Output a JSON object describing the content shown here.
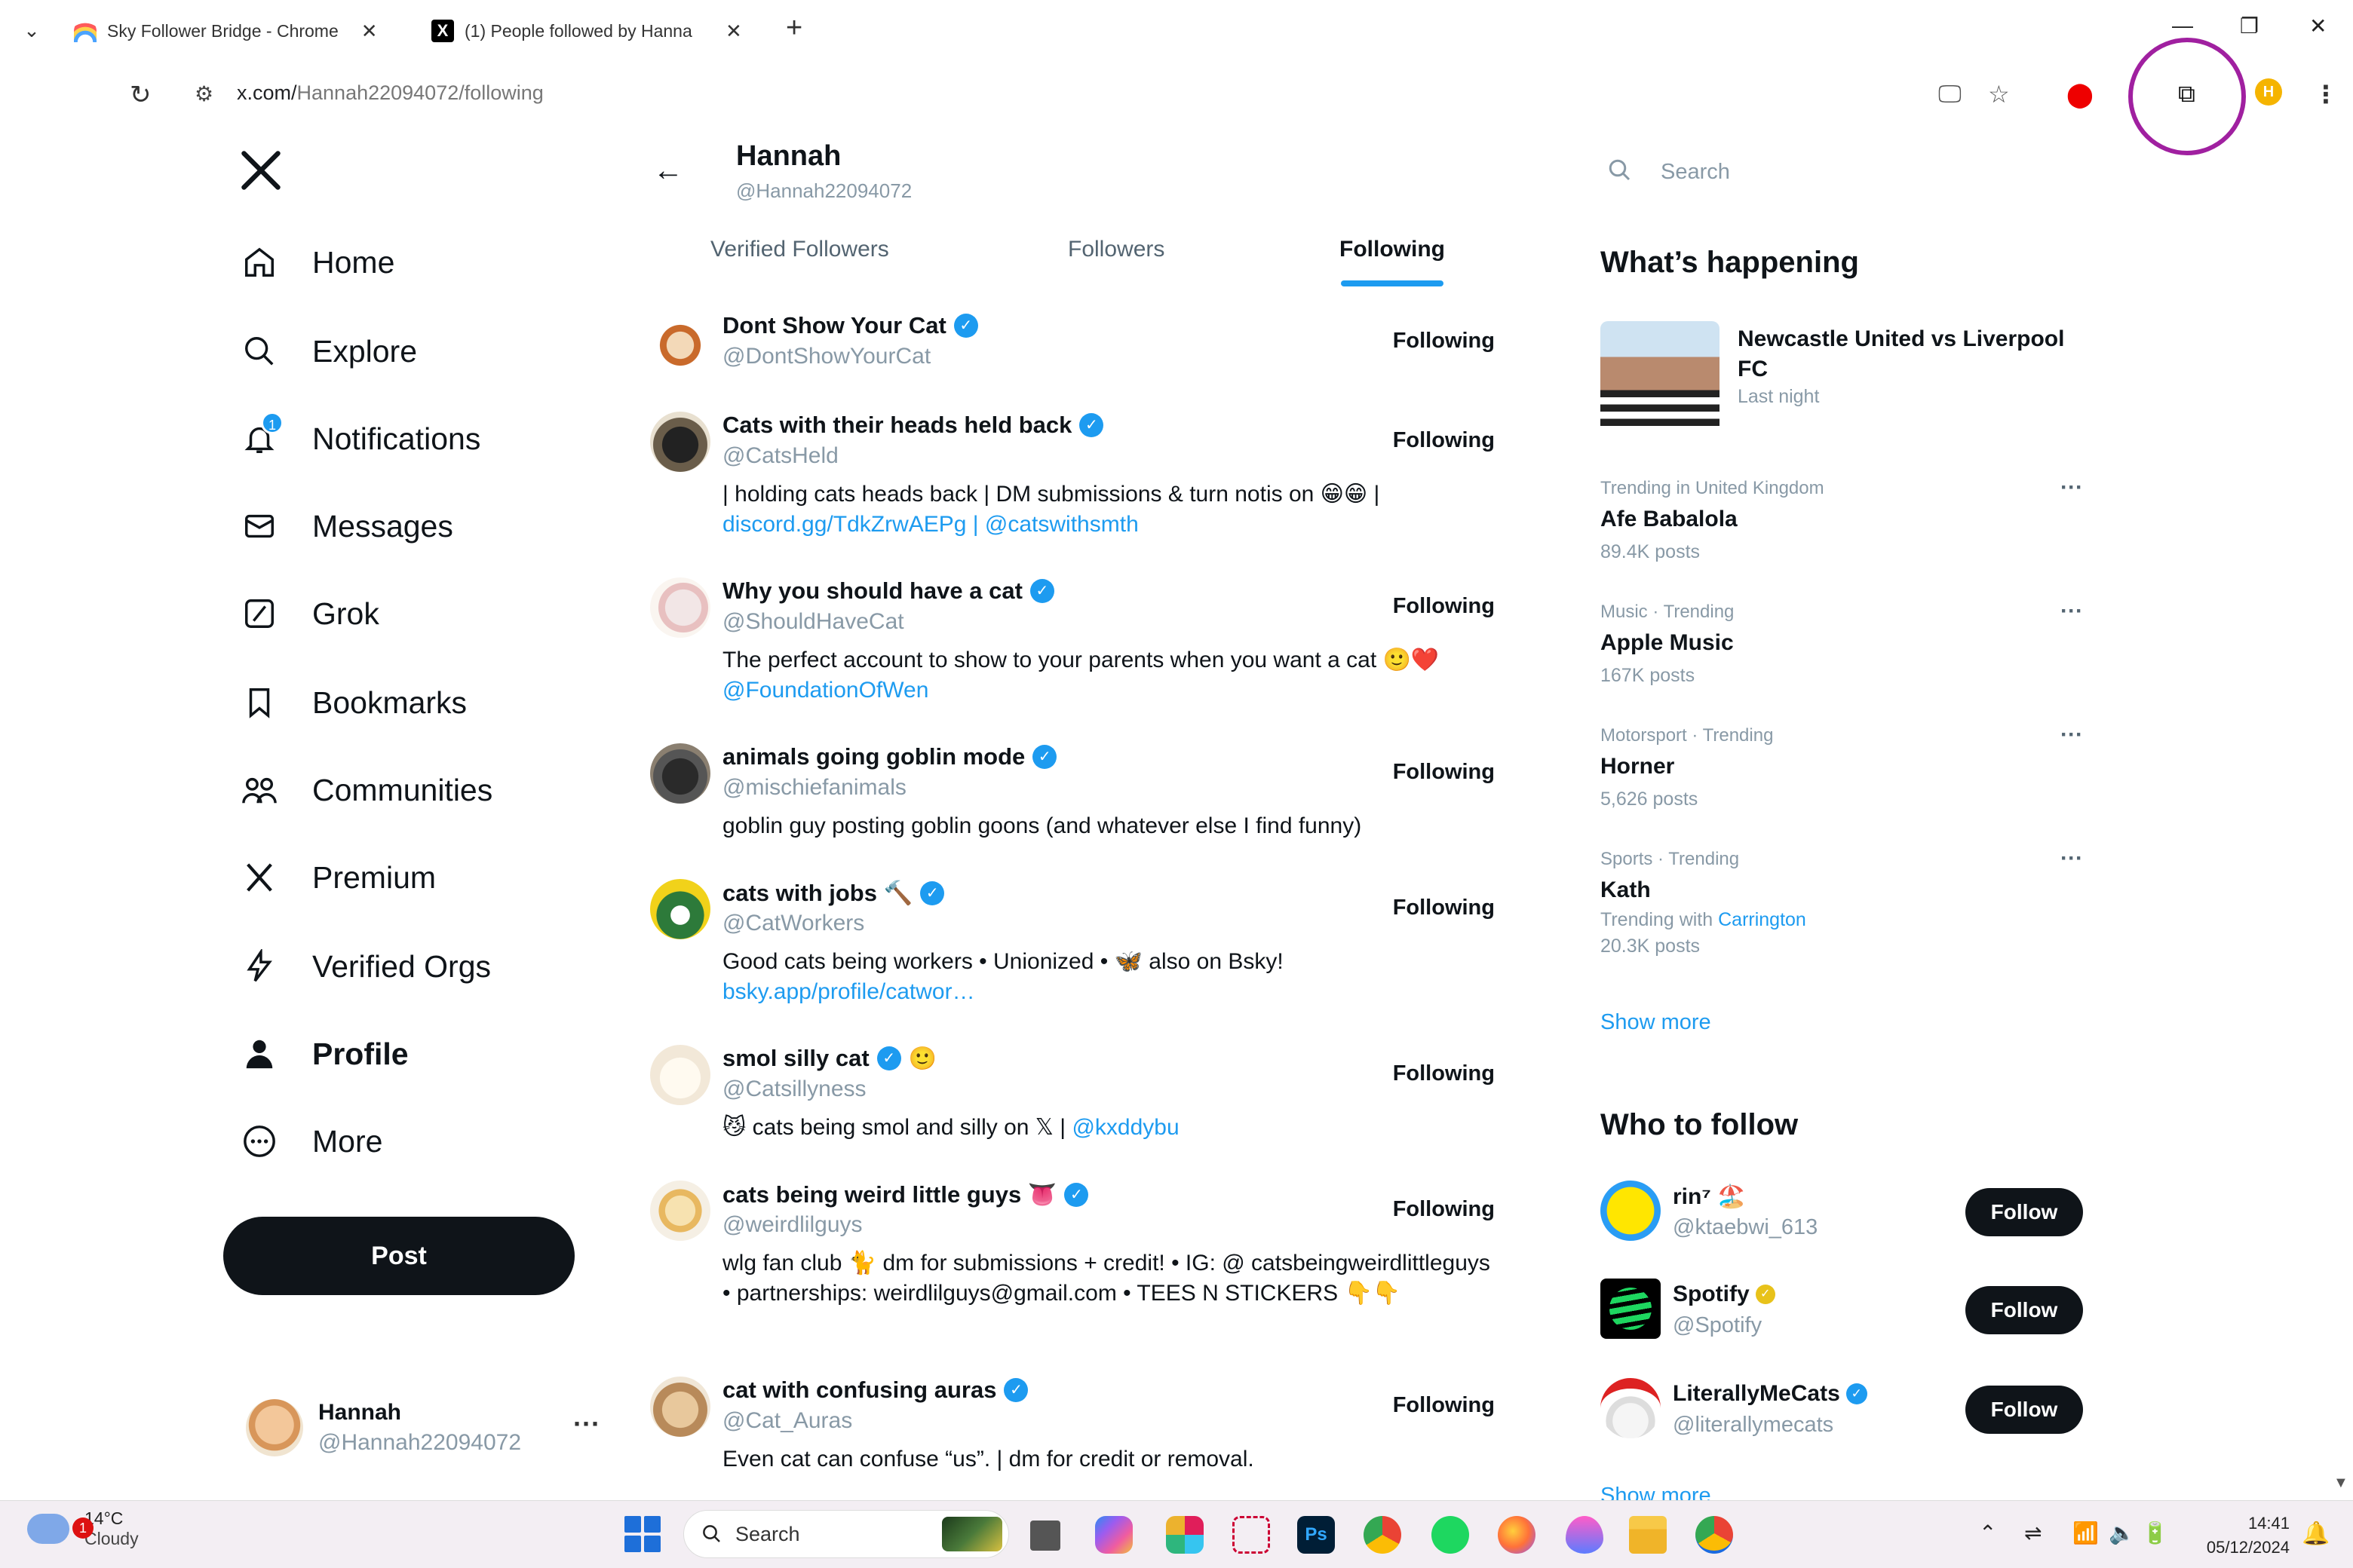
{
  "browser": {
    "tabs": [
      {
        "title": "Sky Follower Bridge - Chrome",
        "icon": "rainbow-icon"
      },
      {
        "title": "(1) People followed by Hanna",
        "icon": "x-logo-icon"
      }
    ],
    "url_host": "x.com/",
    "url_path": "Hannah22094072/following",
    "profile_initial": "H"
  },
  "nav": {
    "items": [
      {
        "label": "Home",
        "icon": "home-icon"
      },
      {
        "label": "Explore",
        "icon": "search-icon"
      },
      {
        "label": "Notifications",
        "icon": "bell-icon"
      },
      {
        "label": "Messages",
        "icon": "mail-icon"
      },
      {
        "label": "Grok",
        "icon": "grok-icon"
      },
      {
        "label": "Bookmarks",
        "icon": "bookmark-icon"
      },
      {
        "label": "Communities",
        "icon": "communities-icon"
      },
      {
        "label": "Premium",
        "icon": "x-logo-icon"
      },
      {
        "label": "Verified Orgs",
        "icon": "lightning-icon"
      },
      {
        "label": "Profile",
        "icon": "person-icon"
      },
      {
        "label": "More",
        "icon": "more-circle-icon"
      }
    ],
    "post_label": "Post",
    "account": {
      "name": "Hannah",
      "handle": "@Hannah22094072"
    }
  },
  "profile": {
    "name": "Hannah",
    "handle": "@Hannah22094072",
    "tabs": [
      "Verified Followers",
      "Followers",
      "Following"
    ],
    "active_tab": "Following"
  },
  "following": [
    {
      "name": "Dont Show Your Cat",
      "handle": "@DontShowYourCat",
      "bio": "",
      "links": "",
      "button": "Following"
    },
    {
      "name": "Cats with their heads held back",
      "handle": "@CatsHeld",
      "bio": "| holding cats heads back | DM submissions & turn notis on 😁😁 |",
      "links": "discord.gg/TdkZrwAEPg | @catswithsmth",
      "button": "Following"
    },
    {
      "name": "Why you should have a cat",
      "handle": "@ShouldHaveCat",
      "bio": "The perfect account to show to your parents when you want a cat 🙂❤️",
      "links": "@FoundationOfWen",
      "button": "Following"
    },
    {
      "name": "animals going goblin mode",
      "handle": "@mischiefanimals",
      "bio": "goblin guy posting goblin goons (and whatever else I find funny)",
      "links": "",
      "button": "Following"
    },
    {
      "name": "cats with jobs 🔨",
      "handle": "@CatWorkers",
      "bio": "Good cats being workers • Unionized • 🦋 also on Bsky!",
      "links": "bsky.app/profile/catwor…",
      "button": "Following"
    },
    {
      "name": "smol silly cat",
      "handle": "@Catsillyness",
      "bio": "😼 cats being smol and silly on 𝕏 |",
      "links": "@kxddybu",
      "button": "Following"
    },
    {
      "name": "cats being weird little guys 👅",
      "handle": "@weirdlilguys",
      "bio": "wlg fan club 🐈 dm for submissions + credit! • IG: @ catsbeingweirdlittleguys • partnerships: weirdlilguys@gmail.com • TEES N STICKERS 👇👇",
      "links": "",
      "button": "Following"
    },
    {
      "name": "cat with confusing auras",
      "handle": "@Cat_Auras",
      "bio": "Even cat can confuse “us”. | dm for credit or removal.",
      "links": "",
      "button": "Following"
    }
  ],
  "sidebar": {
    "search_placeholder": "Search",
    "happening_title": "What’s happening",
    "news": {
      "title": "Newcastle United vs Liverpool FC",
      "subtitle": "Last night"
    },
    "trends": [
      {
        "category": "Trending in United Kingdom",
        "title": "Afe Babalola",
        "count": "89.4K posts",
        "with": ""
      },
      {
        "category": "Music · Trending",
        "title": "Apple Music",
        "count": "167K posts",
        "with": ""
      },
      {
        "category": "Motorsport · Trending",
        "title": "Horner",
        "count": "5,626 posts",
        "with": ""
      },
      {
        "category": "Sports · Trending",
        "title": "Kath",
        "count": "20.3K posts",
        "with_prefix": "Trending with",
        "with": "Carrington"
      }
    ],
    "show_more": "Show more",
    "who_to_follow_title": "Who to follow",
    "who_to_follow": [
      {
        "name": "rin⁷ 🏖️",
        "handle": "@ktaebwi_613",
        "button": "Follow"
      },
      {
        "name": "Spotify",
        "handle": "@Spotify",
        "button": "Follow"
      },
      {
        "name": "LiterallyMeCats",
        "handle": "@literallymecats",
        "button": "Follow"
      }
    ],
    "show_more_2": "Show more"
  },
  "taskbar": {
    "weather_temp": "14°C",
    "weather_desc": "Cloudy",
    "weather_badge": "1",
    "search_label": "Search",
    "time": "14:41",
    "date": "05/12/2024"
  }
}
